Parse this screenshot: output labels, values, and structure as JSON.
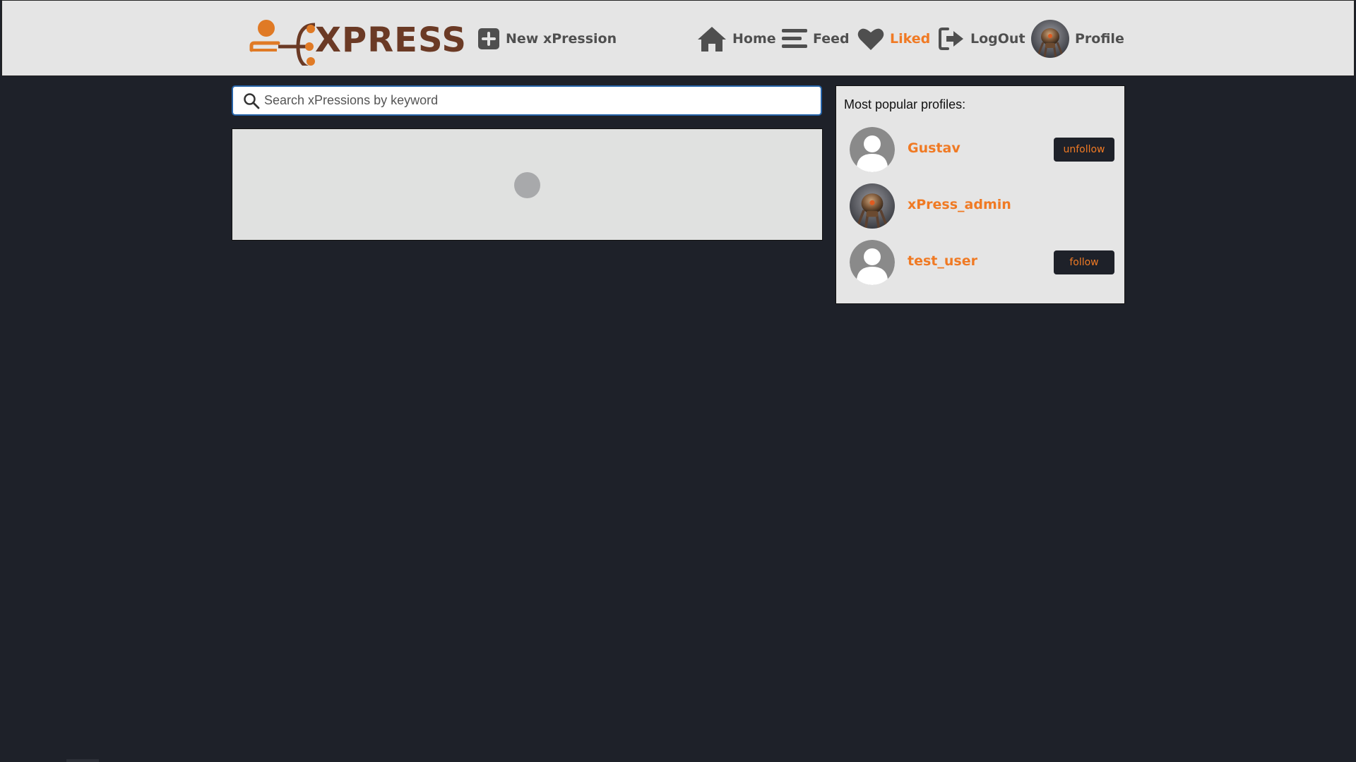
{
  "navbar": {
    "logo_text": "XPRESS",
    "new_label": "New xPression",
    "home_label": "Home",
    "feed_label": "Feed",
    "liked_label": "Liked",
    "logout_label": "LogOut",
    "profile_label": "Profile"
  },
  "colors": {
    "accent": "#f07a24",
    "nav_bg": "#e5e5e5",
    "page_bg": "#1e2129",
    "logo_brown": "#6b3a25",
    "search_border": "#2563a8"
  },
  "search": {
    "placeholder": "Search xPressions by keyword",
    "value": ""
  },
  "popular": {
    "title": "Most popular profiles:",
    "profiles": [
      {
        "name": "Gustav",
        "avatar": "default-avatar-icon",
        "button": "unfollow"
      },
      {
        "name": "xPress_admin",
        "avatar": "robot-avatar",
        "button": ""
      },
      {
        "name": "test_user",
        "avatar": "default-avatar-icon",
        "button": "follow"
      }
    ]
  },
  "icons": {
    "new": "plus-square-icon",
    "home": "home-icon",
    "feed": "bars-icon",
    "liked": "heart-icon",
    "logout": "logout-icon",
    "search": "search-icon"
  }
}
